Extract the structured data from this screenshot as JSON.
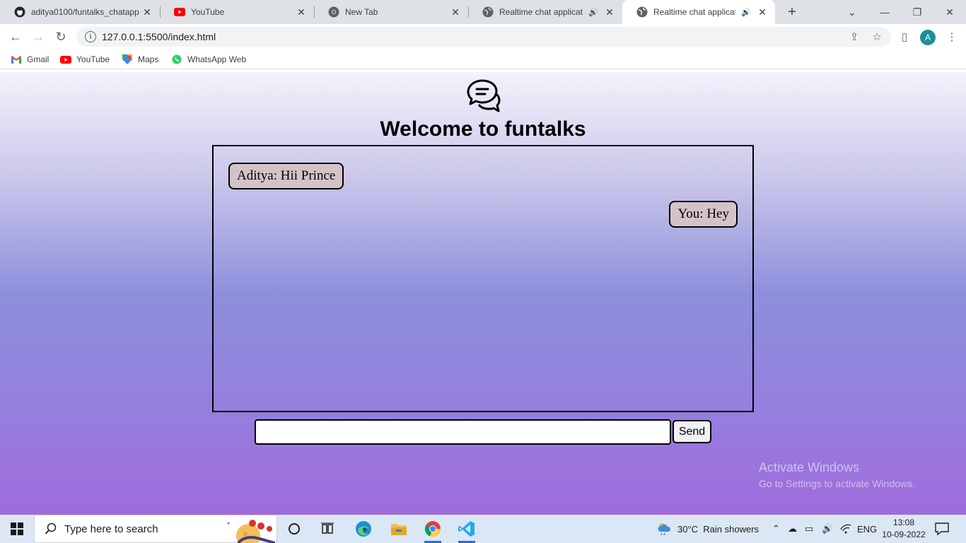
{
  "browser": {
    "tabs": [
      {
        "title": "aditya0100/funtalks_chatapp",
        "icon": "github-icon"
      },
      {
        "title": "YouTube",
        "icon": "youtube-icon"
      },
      {
        "title": "New Tab",
        "icon": "chrome-icon"
      },
      {
        "title": "Realtime chat application",
        "icon": "globe-icon",
        "audio": true
      },
      {
        "title": "Realtime chat application",
        "icon": "globe-icon",
        "audio": true,
        "active": true
      }
    ],
    "url": "127.0.0.1:5500/index.html",
    "profile_initial": "A",
    "bookmarks": [
      {
        "label": "Gmail",
        "icon": "gmail-icon"
      },
      {
        "label": "YouTube",
        "icon": "youtube-icon"
      },
      {
        "label": "Maps",
        "icon": "maps-icon"
      },
      {
        "label": "WhatsApp Web",
        "icon": "whatsapp-icon"
      }
    ]
  },
  "page": {
    "heading": "Welcome to funtalks",
    "messages": [
      {
        "text": "Aditya: Hii Prince",
        "position": "left"
      },
      {
        "text": "You: Hey",
        "position": "right"
      }
    ],
    "input_value": "",
    "send_label": "Send",
    "watermark_title": "Activate Windows",
    "watermark_sub": "Go to Settings to activate Windows."
  },
  "taskbar": {
    "search_placeholder": "Type here to search",
    "weather": "30°C  Rain showers",
    "lang": "ENG",
    "time": "13:08",
    "date": "10-09-2022"
  },
  "colors": {
    "message_bubble": "#d4c3c6",
    "profile_avatar": "#1a8f9a"
  }
}
